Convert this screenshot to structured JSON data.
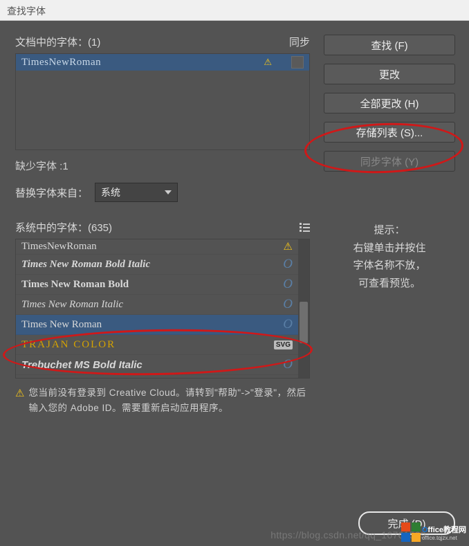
{
  "window": {
    "title": "查找字体"
  },
  "doc_fonts": {
    "header": "文档中的字体：(1)",
    "sync_label": "同步",
    "items": [
      {
        "name": "TimesNewRoman",
        "warning": true
      }
    ]
  },
  "missing": {
    "label": "缺少字体 :1"
  },
  "replace": {
    "label": "替换字体来自：",
    "value": "系统"
  },
  "sys_fonts": {
    "header": "系统中的字体：(635)",
    "items": [
      {
        "name": "TimesNewRoman",
        "badge_type": "warn",
        "cut": true,
        "font_class": "f-tnr"
      },
      {
        "name": "Times New Roman Bold Italic",
        "badge_type": "O",
        "font_class": "f-tnr-bi"
      },
      {
        "name": "Times New Roman Bold",
        "badge_type": "O",
        "font_class": "f-tnr-b"
      },
      {
        "name": "Times New Roman Italic",
        "badge_type": "O",
        "font_class": "f-tnr-i"
      },
      {
        "name": "Times New Roman",
        "badge_type": "O",
        "selected": true,
        "font_class": "f-tnr"
      },
      {
        "name": "TRAJAN COLOR",
        "badge_type": "SVG",
        "font_class": "f-trajan"
      },
      {
        "name": "Trebuchet MS Bold Italic",
        "badge_type": "O",
        "font_class": "f-treb"
      }
    ]
  },
  "info": {
    "text": "您当前没有登录到 Creative Cloud。请转到\"帮助\"->\"登录\"，然后输入您的 Adobe ID。需要重新启动应用程序。"
  },
  "buttons": {
    "find": "查找 (F)",
    "change": "更改",
    "change_all": "全部更改 (H)",
    "save_list": "存储列表 (S)...",
    "sync_fonts": "同步字体 (Y)",
    "done": "完成 (D)"
  },
  "hint": {
    "title": "提示：",
    "body1": "右键单击并按住",
    "body2": "字体名称不放，",
    "body3": "可查看预览。"
  },
  "watermark": "https://blog.csdn.net/qq_16761599",
  "logo": {
    "line1_prefix": "O",
    "line1_rest": "ffice教程网",
    "line2": "office.tqjzx.net"
  }
}
